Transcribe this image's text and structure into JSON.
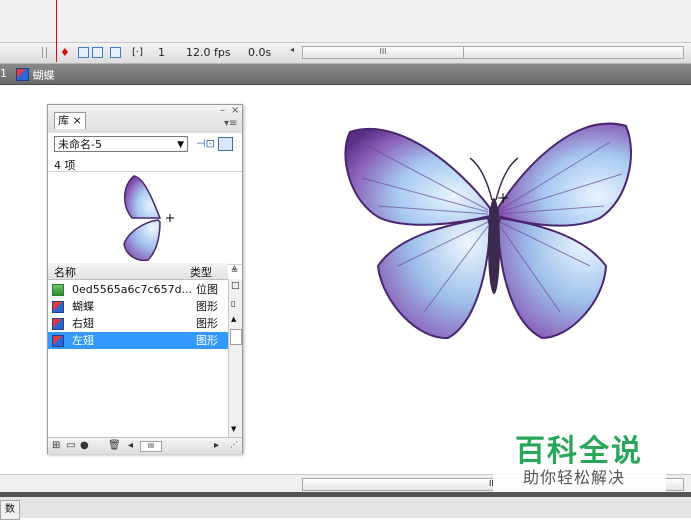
{
  "timeline": {
    "frame_number": "1",
    "fps": "12.0 fps",
    "time": "0.0s",
    "scroll_thumb": "III"
  },
  "editbar": {
    "scene_crumb": "1",
    "symbol_crumb": "蝴蝶"
  },
  "library": {
    "tab_label": "库",
    "tab_close": "×",
    "minimize": "–",
    "close": "×",
    "menu": "▾≡",
    "document_select": "未命名-5",
    "item_count": "4 项",
    "columns": {
      "name": "名称",
      "type": "类型"
    },
    "items": [
      {
        "name": "0ed5565a6c7c657d...",
        "type": "位图",
        "icon": "bitmap-icon",
        "selected": false
      },
      {
        "name": "蝴蝶",
        "type": "图形",
        "icon": "graphic-symbol-icon",
        "selected": false
      },
      {
        "name": "右翅",
        "type": "图形",
        "icon": "graphic-symbol-icon",
        "selected": false
      },
      {
        "name": "左翅",
        "type": "图形",
        "icon": "graphic-symbol-icon",
        "selected": true
      }
    ],
    "hscroll_thumb": "III"
  },
  "bottom": {
    "scroll_thumb": "II",
    "props_tab": "数"
  },
  "watermark": {
    "title": "百科全说",
    "subtitle": "助你轻松解决"
  },
  "colors": {
    "selection": "#3399ff",
    "watermark_green": "#2aa65a",
    "playhead": "#d01010"
  }
}
